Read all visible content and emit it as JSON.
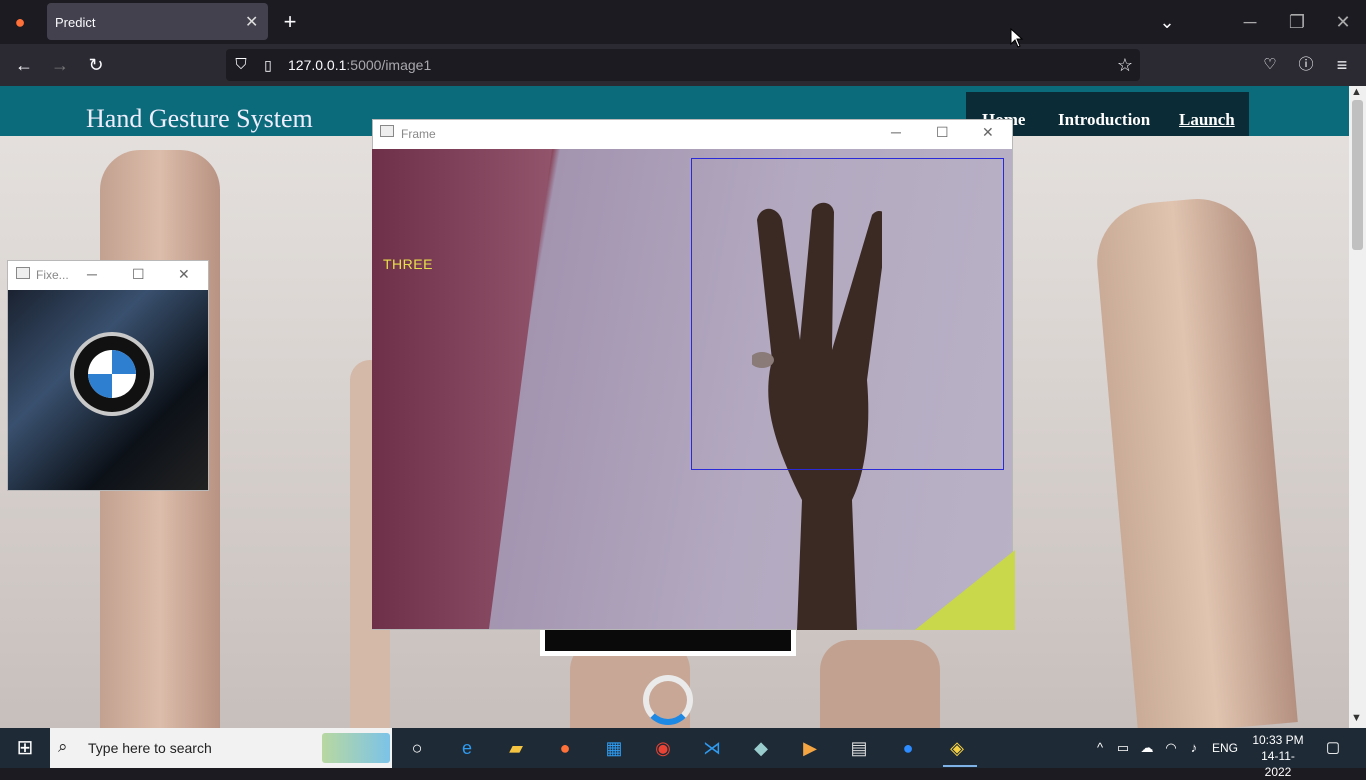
{
  "browser": {
    "tab_title": "Predict",
    "tab_close": "✕",
    "new_tab": "+",
    "url_host": "127.0.0.1",
    "url_rest": ":5000/image1"
  },
  "site": {
    "brand": "Hand Gesture System",
    "nav": [
      "Home",
      "Introduction",
      "Launch"
    ]
  },
  "frame_window": {
    "title": "Frame",
    "prediction": "THREE"
  },
  "fixed_window": {
    "title": "Fixe..."
  },
  "taskbar": {
    "search_placeholder": "Type here to search",
    "language": "ENG",
    "time": "10:33 PM",
    "date": "14-11-2022"
  },
  "colors": {
    "header": "#0c6b7a",
    "menu_bg": "#0b2b36",
    "bbox": "#2a2ad8",
    "prediction_text": "#e8e04a"
  }
}
